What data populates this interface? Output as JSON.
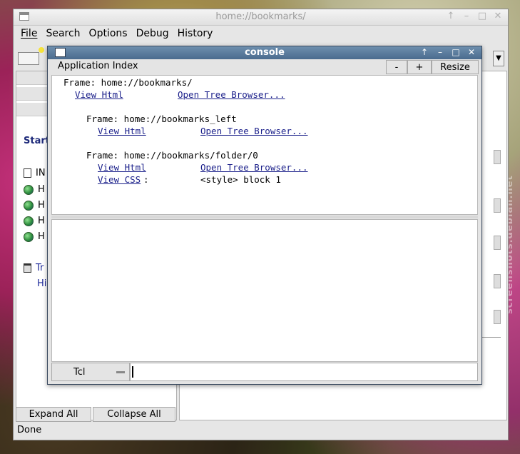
{
  "main_window": {
    "title": "home://bookmarks/",
    "titlebar_buttons": [
      "↑",
      "–",
      "□",
      "✕"
    ],
    "menu": [
      "File",
      "Search",
      "Options",
      "Debug",
      "History"
    ],
    "left_panel": {
      "heading": "Start",
      "items": [
        {
          "icon": "document-icon",
          "label": "IN"
        },
        {
          "icon": "globe-icon",
          "label": "H"
        },
        {
          "icon": "globe-icon",
          "label": "H"
        },
        {
          "icon": "globe-icon",
          "label": "H"
        },
        {
          "icon": "globe-icon",
          "label": "H"
        }
      ],
      "trash_label": "Tr",
      "history_label": "Hi"
    },
    "expand_all": "Expand All",
    "collapse_all": "Collapse All",
    "status": "Done"
  },
  "console": {
    "title": "console",
    "titlebar_buttons": [
      "↑",
      "–",
      "□",
      "✕"
    ],
    "app_index": "Application Index",
    "minus": "-",
    "plus": "+",
    "resize": "Resize",
    "frames": [
      {
        "label": "Frame: home://bookmarks/",
        "view_html": "View Html",
        "tree": "Open Tree Browser..."
      },
      {
        "label": "Frame: home://bookmarks_left",
        "view_html": "View Html",
        "tree": "Open Tree Browser..."
      },
      {
        "label": "Frame: home://bookmarks/folder/0",
        "view_html": "View Html",
        "tree": "Open Tree Browser...",
        "view_css": "View CSS",
        "css_colon": ":",
        "style_block": "<style> block 1"
      }
    ],
    "language": "Tcl",
    "command": ""
  },
  "watermark": "screenshots.debian.net"
}
